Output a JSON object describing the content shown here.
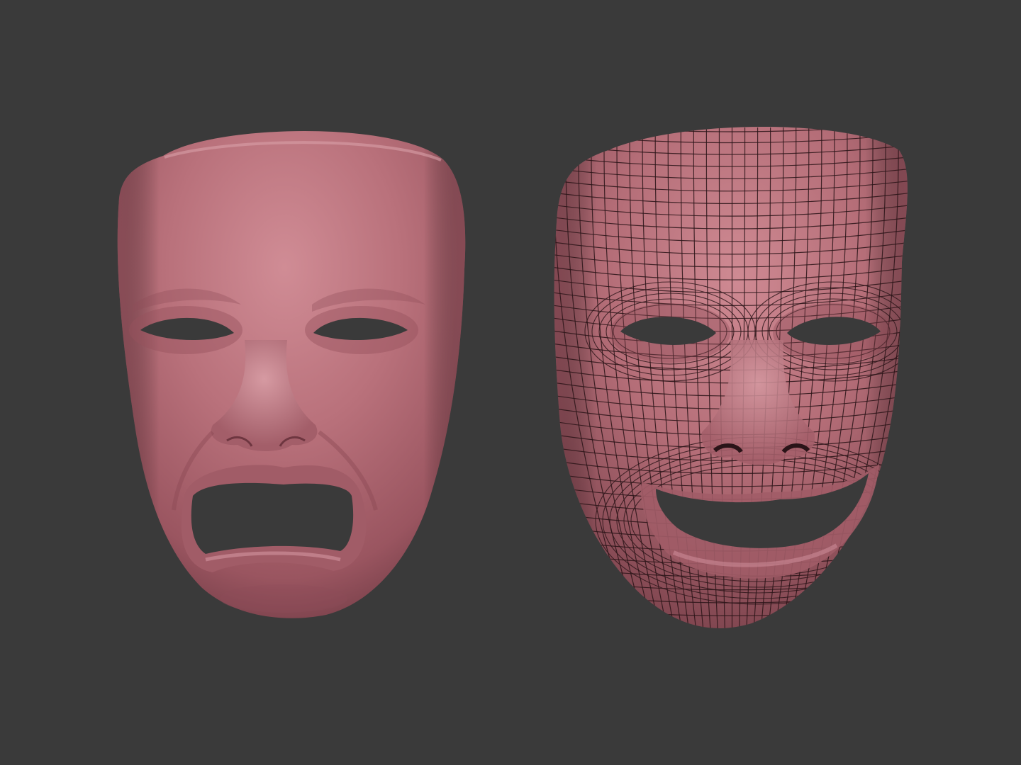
{
  "scene": {
    "background_color": "#3a3a3a",
    "mask_base_color": "#b06a74",
    "mask_highlight_color": "#cf8b94",
    "mask_shadow_color": "#7e4550",
    "wire_color": "#2a1418",
    "objects": [
      {
        "name": "tragedy-mask",
        "expression": "sad",
        "display": "smooth-shaded"
      },
      {
        "name": "comedy-mask",
        "expression": "happy",
        "display": "wireframe-over-shaded"
      }
    ]
  }
}
